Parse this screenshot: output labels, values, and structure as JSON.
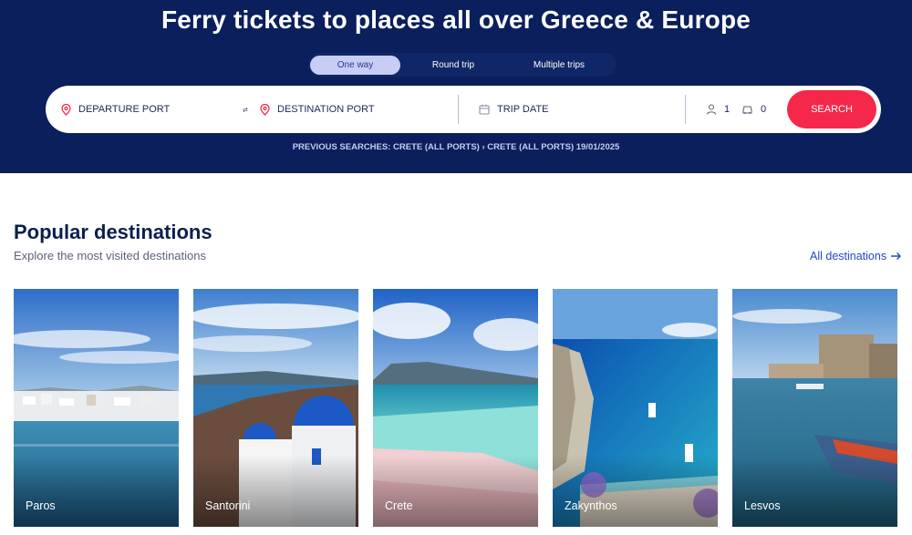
{
  "hero": {
    "title": "Ferry tickets to places all over Greece & Europe",
    "tabs": [
      {
        "label": "One way",
        "active": true
      },
      {
        "label": "Round trip",
        "active": false
      },
      {
        "label": "Multiple trips",
        "active": false
      }
    ]
  },
  "search": {
    "departure_label": "DEPARTURE PORT",
    "destination_label": "DESTINATION PORT",
    "date_label": "TRIP DATE",
    "passengers": "1",
    "vehicles": "0",
    "button_label": "SEARCH",
    "previous_searches": "PREVIOUS SEARCHES: CRETE (ALL PORTS) › CRETE (ALL PORTS) 19/01/2025"
  },
  "destinations": {
    "title": "Popular destinations",
    "subtitle": "Explore the most visited destinations",
    "all_link": "All destinations",
    "cards": [
      {
        "name": "Paros"
      },
      {
        "name": "Santorini"
      },
      {
        "name": "Crete"
      },
      {
        "name": "Zakynthos"
      },
      {
        "name": "Lesvos"
      }
    ]
  },
  "colors": {
    "hero_bg": "#0a1f5c",
    "accent": "#f5274b",
    "link": "#2346c7",
    "active_tab": "#c7cdf5"
  },
  "icons": {
    "departure": "map-pin-icon",
    "destination": "map-pin-icon",
    "swap": "swap-arrows-icon",
    "date": "calendar-icon",
    "passengers": "person-icon",
    "vehicles": "car-icon",
    "all_link": "arrow-right-icon"
  }
}
